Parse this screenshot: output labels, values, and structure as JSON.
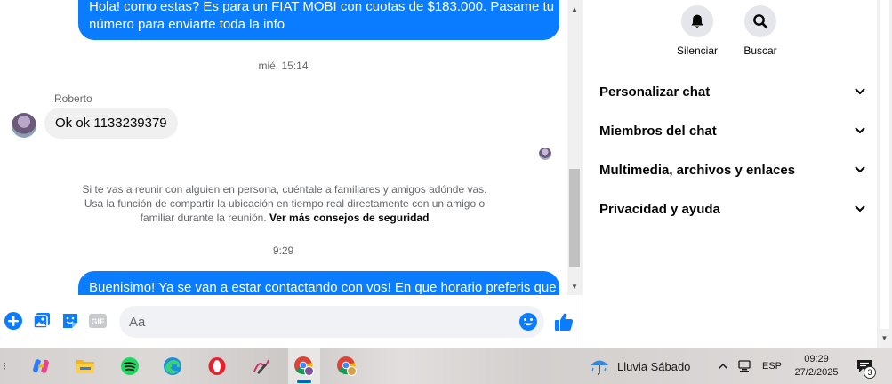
{
  "chat": {
    "outgoing_top_lines": [
      "Hola! como estas? Es para un FIAT MOBI con cuotas de $183.000. Pasame tu",
      "número para enviarte toda la info"
    ],
    "timestamp_1": "mié, 15:14",
    "sender_name": "Roberto",
    "incoming_message": "Ok ok 1133239379",
    "safety_notice": "Si te vas a reunir con alguien en persona, cuéntale a familiares y amigos adónde vas. Usa la función de compartir la ubicación en tiempo real directamente con un amigo o familiar durante la reunión.",
    "safety_link": "Ver más consejos de seguridad",
    "timestamp_2": "9:29",
    "outgoing_bottom": "Buenisimo! Ya se van a estar contactando con vos! En que horario preferis que"
  },
  "composer": {
    "placeholder": "Aa",
    "value": "",
    "icons": [
      "add-icon",
      "photo-icon",
      "sticker-icon",
      "gif-icon",
      "emoji-icon",
      "like-icon"
    ],
    "gif_label": "GIF"
  },
  "right_panel": {
    "actions": [
      {
        "label": "Silenciar",
        "icon": "bell-icon"
      },
      {
        "label": "Buscar",
        "icon": "search-icon"
      }
    ],
    "menu": [
      {
        "label": "Personalizar chat"
      },
      {
        "label": "Miembros del chat"
      },
      {
        "label": "Multimedia, archivos y enlaces"
      },
      {
        "label": "Privacidad y ayuda"
      }
    ]
  },
  "taskbar": {
    "apps": [
      "copilot-icon",
      "file-explorer-icon",
      "spotify-icon",
      "edge-icon",
      "opera-icon",
      "pen-icon",
      "chrome-profile-icon",
      "chrome-icon"
    ],
    "weather": "Lluvia Sábado",
    "language": "ESP",
    "time": "09:29",
    "date": "27/2/2025",
    "notification_count": "3"
  },
  "colors": {
    "accent": "#0a7cff",
    "incoming_bubble": "#f0f0f0",
    "input_bg": "#f0f2f5",
    "text_secondary": "#65676b"
  }
}
